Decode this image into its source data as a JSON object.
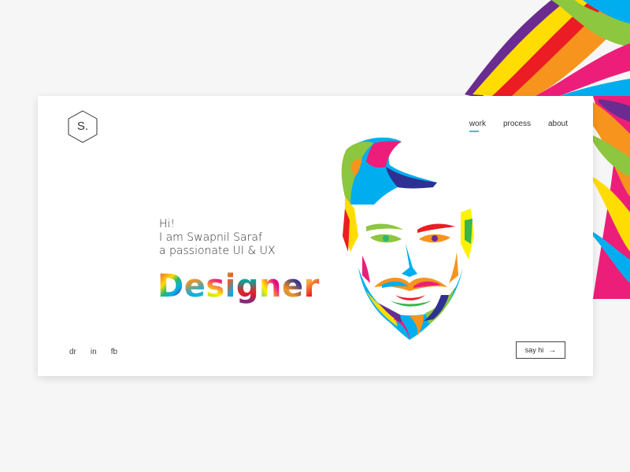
{
  "logo": {
    "letter": "S."
  },
  "nav": {
    "items": [
      {
        "label": "work",
        "active": true
      },
      {
        "label": "process",
        "active": false
      },
      {
        "label": "about",
        "active": false
      }
    ]
  },
  "intro": {
    "line1": "Hi!",
    "line2": "I am Swapnil Saraf",
    "line3": "a passionate UI & UX"
  },
  "headline": {
    "letters": [
      "D",
      "e",
      "s",
      "i",
      "g",
      "n",
      "e",
      "r"
    ]
  },
  "social": {
    "items": [
      "dr",
      "in",
      "fb"
    ]
  },
  "cta": {
    "label": "say hi",
    "arrow_icon": "arrow-right-icon"
  },
  "colors": {
    "accent": "#4bb5e5",
    "background": "#f6f6f6",
    "card": "#ffffff",
    "text": "#333333"
  }
}
